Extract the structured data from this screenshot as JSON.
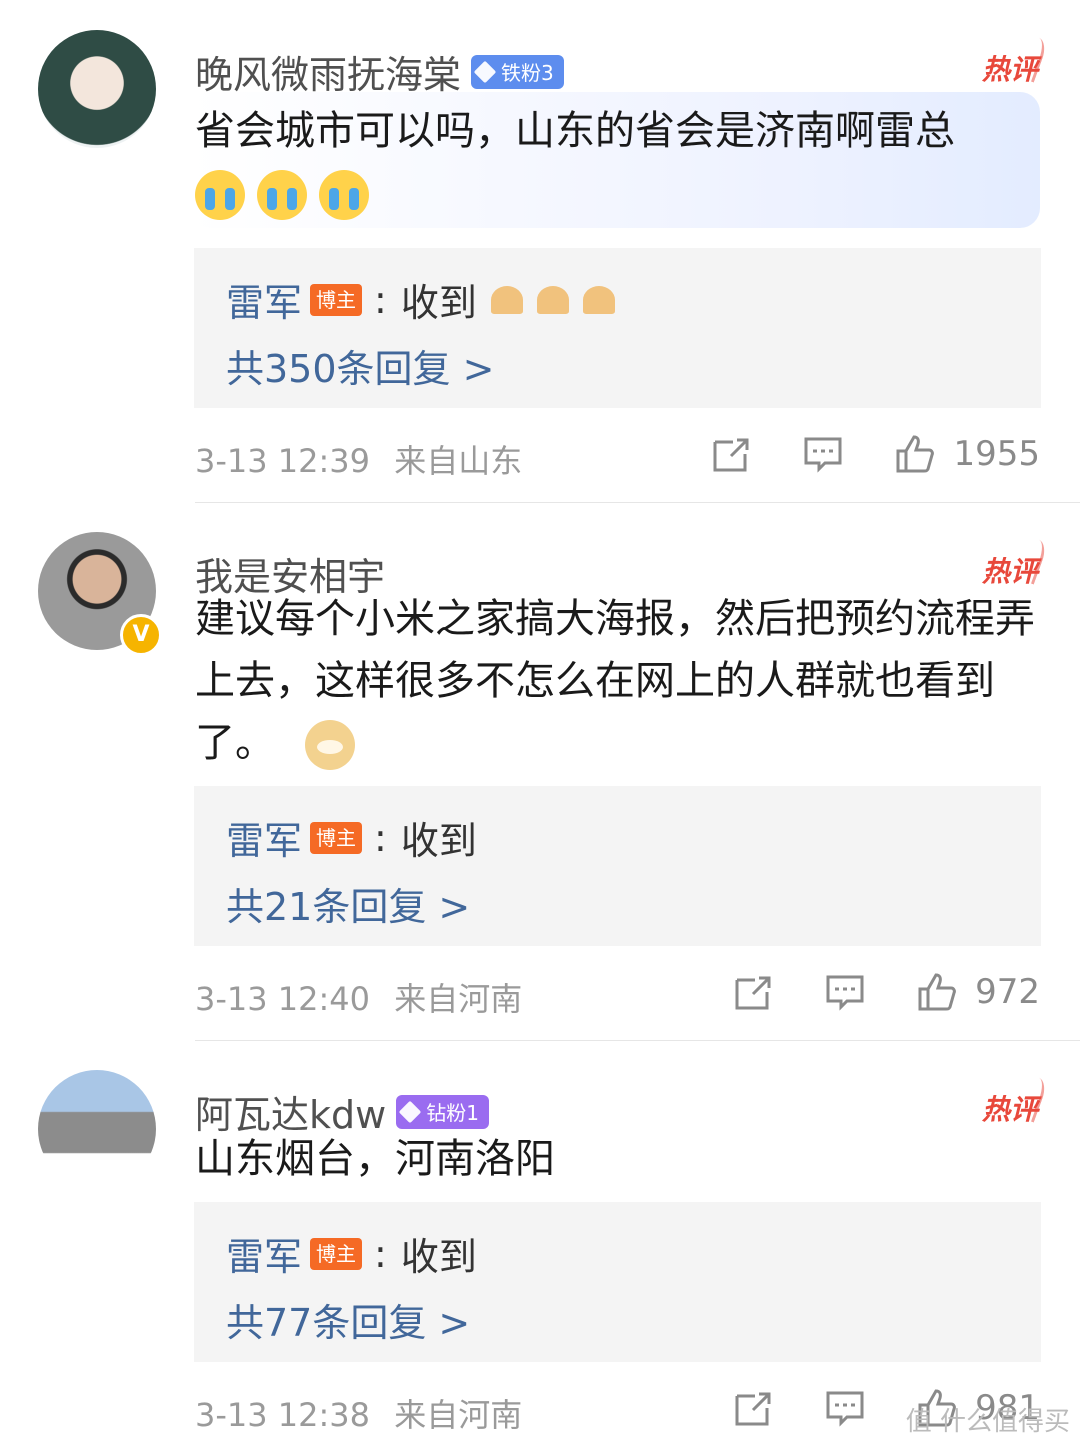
{
  "comments": [
    {
      "username": "晚风微雨抚海棠",
      "fan_badge": "铁粉3",
      "fan_badge_color": "#5d8dee",
      "hot_label": "热评",
      "text": "省会城市可以吗，山东的省会是济南啊雷总",
      "reply": {
        "name": "雷军",
        "badge": "博主",
        "text": "收到"
      },
      "reply_count": "共350条回复 >",
      "time": "3-13 12:39",
      "location": "来自山东",
      "likes": "1955"
    },
    {
      "username": "我是安相宇",
      "hot_label": "热评",
      "text": "建议每个小米之家搞大海报，然后把预约流程弄上去，这样很多不怎么在网上的人群就也看到了。",
      "reply": {
        "name": "雷军",
        "badge": "博主",
        "text": "收到"
      },
      "reply_count": "共21条回复 >",
      "time": "3-13 12:40",
      "location": "来自河南",
      "likes": "972"
    },
    {
      "username": "阿瓦达kdw",
      "fan_badge": "钻粉1",
      "fan_badge_color": "#9a6cf0",
      "hot_label": "热评",
      "text": "山东烟台，河南洛阳",
      "reply": {
        "name": "雷军",
        "badge": "博主",
        "text": "收到"
      },
      "reply_count": "共77条回复 >",
      "time": "3-13 12:38",
      "location": "来自河南",
      "likes": "981"
    }
  ],
  "watermark": "值 什么值得买",
  "colors": {
    "link": "#41679a",
    "hot": "#e8483b",
    "blogger_badge": "#f56a25"
  }
}
